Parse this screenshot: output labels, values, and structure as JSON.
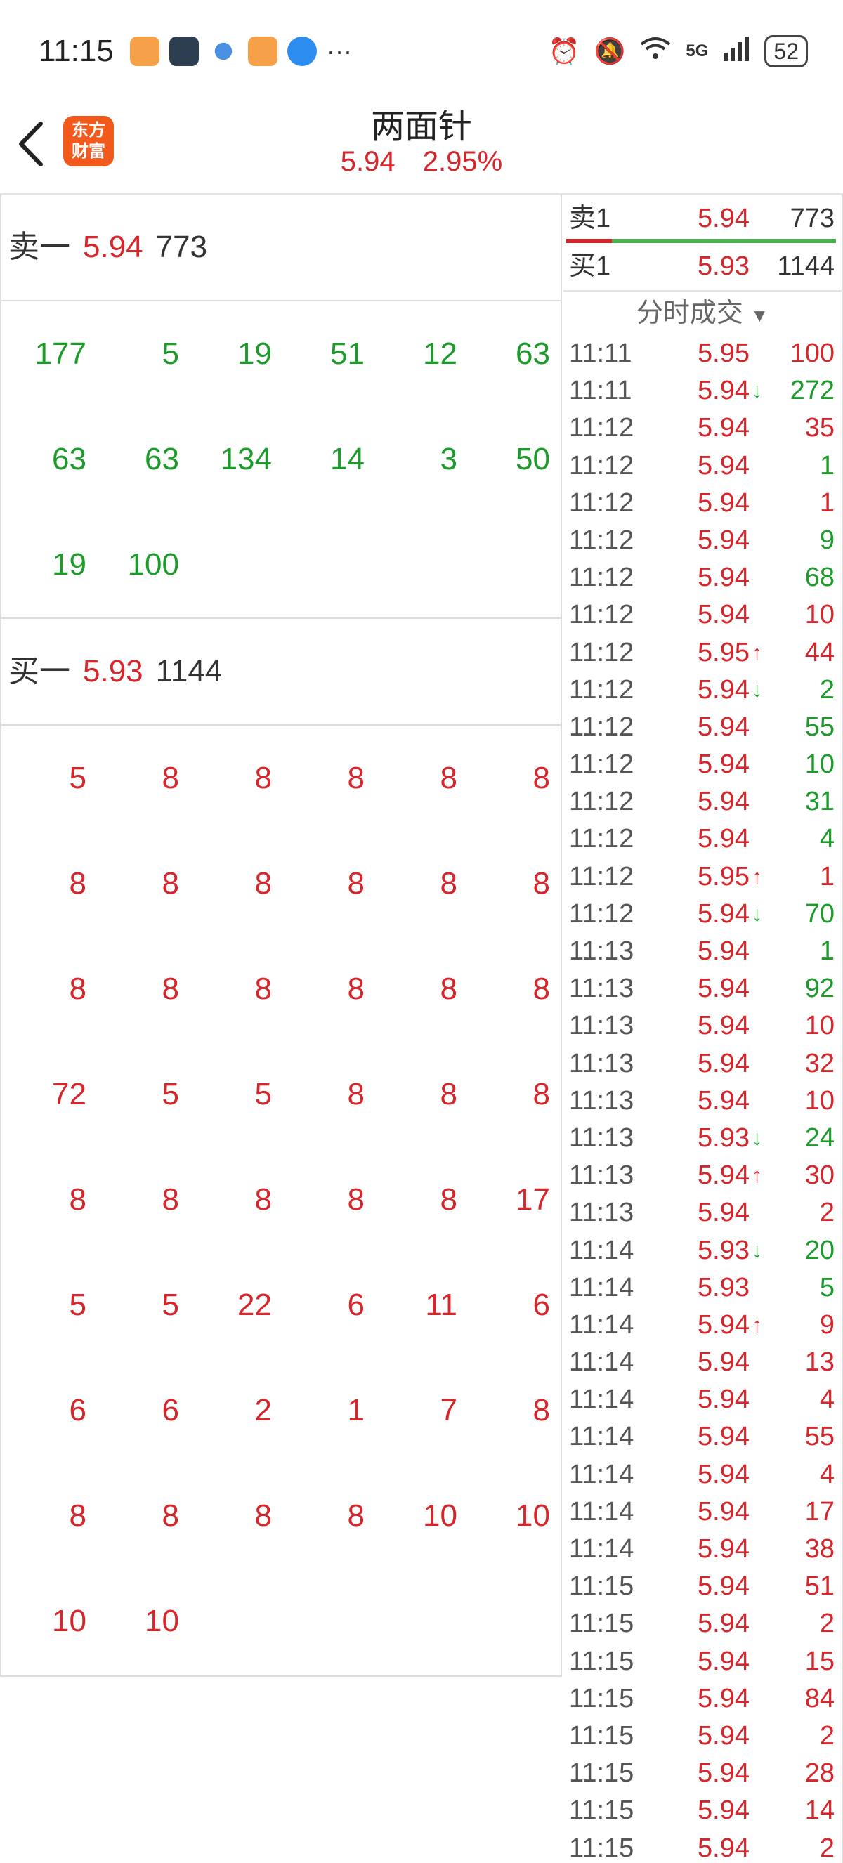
{
  "status_bar": {
    "time": "11:15",
    "battery": "52",
    "network": "5G",
    "more": "···",
    "icons_left": [
      "app-orange-heart-icon",
      "app-bot-icon",
      "app-planet-icon",
      "app-orange-heart-icon",
      "app-cloud-icon"
    ],
    "icons_right": [
      "alarm-icon",
      "mute-icon",
      "wifi-icon",
      "signal-icon",
      "battery-icon"
    ]
  },
  "header": {
    "logo_line1": "东方",
    "logo_line2": "财富",
    "title": "两面针",
    "price": "5.94",
    "change_pct": "2.95%",
    "logo_color": "#f25a1d"
  },
  "sell_one": {
    "label": "卖一",
    "price": "5.94",
    "qty": "773"
  },
  "sell_queue": [
    [
      "177",
      "5",
      "19",
      "51",
      "12",
      "63"
    ],
    [
      "63",
      "63",
      "134",
      "14",
      "3",
      "50"
    ],
    [
      "19",
      "100"
    ]
  ],
  "buy_one": {
    "label": "买一",
    "price": "5.93",
    "qty": "1144"
  },
  "buy_queue": [
    [
      "5",
      "8",
      "8",
      "8",
      "8",
      "8"
    ],
    [
      "8",
      "8",
      "8",
      "8",
      "8",
      "8"
    ],
    [
      "8",
      "8",
      "8",
      "8",
      "8",
      "8"
    ],
    [
      "72",
      "5",
      "5",
      "8",
      "8",
      "8"
    ],
    [
      "8",
      "8",
      "8",
      "8",
      "8",
      "17"
    ],
    [
      "5",
      "5",
      "22",
      "6",
      "11",
      "6"
    ],
    [
      "6",
      "6",
      "2",
      "1",
      "7",
      "8"
    ],
    [
      "8",
      "8",
      "8",
      "8",
      "10",
      "10"
    ],
    [
      "10",
      "10"
    ]
  ],
  "order_book": {
    "sell1": {
      "label": "卖1",
      "price": "5.94",
      "qty": "773"
    },
    "buy1": {
      "label": "买1",
      "price": "5.93",
      "qty": "1144"
    },
    "sell_ratio": 0.17
  },
  "trades_header": "分时成交",
  "trades": [
    {
      "time": "11:11",
      "price": "5.95",
      "arrow": "",
      "vol": "100",
      "dir": "buy"
    },
    {
      "time": "11:11",
      "price": "5.94",
      "arrow": "down",
      "vol": "272",
      "dir": "sell"
    },
    {
      "time": "11:12",
      "price": "5.94",
      "arrow": "",
      "vol": "35",
      "dir": "buy"
    },
    {
      "time": "11:12",
      "price": "5.94",
      "arrow": "",
      "vol": "1",
      "dir": "sell"
    },
    {
      "time": "11:12",
      "price": "5.94",
      "arrow": "",
      "vol": "1",
      "dir": "buy"
    },
    {
      "time": "11:12",
      "price": "5.94",
      "arrow": "",
      "vol": "9",
      "dir": "sell"
    },
    {
      "time": "11:12",
      "price": "5.94",
      "arrow": "",
      "vol": "68",
      "dir": "sell"
    },
    {
      "time": "11:12",
      "price": "5.94",
      "arrow": "",
      "vol": "10",
      "dir": "buy"
    },
    {
      "time": "11:12",
      "price": "5.95",
      "arrow": "up",
      "vol": "44",
      "dir": "buy"
    },
    {
      "time": "11:12",
      "price": "5.94",
      "arrow": "down",
      "vol": "2",
      "dir": "sell"
    },
    {
      "time": "11:12",
      "price": "5.94",
      "arrow": "",
      "vol": "55",
      "dir": "sell"
    },
    {
      "time": "11:12",
      "price": "5.94",
      "arrow": "",
      "vol": "10",
      "dir": "sell"
    },
    {
      "time": "11:12",
      "price": "5.94",
      "arrow": "",
      "vol": "31",
      "dir": "sell"
    },
    {
      "time": "11:12",
      "price": "5.94",
      "arrow": "",
      "vol": "4",
      "dir": "sell"
    },
    {
      "time": "11:12",
      "price": "5.95",
      "arrow": "up",
      "vol": "1",
      "dir": "buy"
    },
    {
      "time": "11:12",
      "price": "5.94",
      "arrow": "down",
      "vol": "70",
      "dir": "sell"
    },
    {
      "time": "11:13",
      "price": "5.94",
      "arrow": "",
      "vol": "1",
      "dir": "sell"
    },
    {
      "time": "11:13",
      "price": "5.94",
      "arrow": "",
      "vol": "92",
      "dir": "sell"
    },
    {
      "time": "11:13",
      "price": "5.94",
      "arrow": "",
      "vol": "10",
      "dir": "buy"
    },
    {
      "time": "11:13",
      "price": "5.94",
      "arrow": "",
      "vol": "32",
      "dir": "buy"
    },
    {
      "time": "11:13",
      "price": "5.94",
      "arrow": "",
      "vol": "10",
      "dir": "buy"
    },
    {
      "time": "11:13",
      "price": "5.93",
      "arrow": "down",
      "vol": "24",
      "dir": "sell"
    },
    {
      "time": "11:13",
      "price": "5.94",
      "arrow": "up",
      "vol": "30",
      "dir": "buy"
    },
    {
      "time": "11:13",
      "price": "5.94",
      "arrow": "",
      "vol": "2",
      "dir": "buy"
    },
    {
      "time": "11:14",
      "price": "5.93",
      "arrow": "down",
      "vol": "20",
      "dir": "sell"
    },
    {
      "time": "11:14",
      "price": "5.93",
      "arrow": "",
      "vol": "5",
      "dir": "sell"
    },
    {
      "time": "11:14",
      "price": "5.94",
      "arrow": "up",
      "vol": "9",
      "dir": "buy"
    },
    {
      "time": "11:14",
      "price": "5.94",
      "arrow": "",
      "vol": "13",
      "dir": "buy"
    },
    {
      "time": "11:14",
      "price": "5.94",
      "arrow": "",
      "vol": "4",
      "dir": "buy"
    },
    {
      "time": "11:14",
      "price": "5.94",
      "arrow": "",
      "vol": "55",
      "dir": "buy"
    },
    {
      "time": "11:14",
      "price": "5.94",
      "arrow": "",
      "vol": "4",
      "dir": "buy"
    },
    {
      "time": "11:14",
      "price": "5.94",
      "arrow": "",
      "vol": "17",
      "dir": "buy"
    },
    {
      "time": "11:14",
      "price": "5.94",
      "arrow": "",
      "vol": "38",
      "dir": "buy"
    },
    {
      "time": "11:15",
      "price": "5.94",
      "arrow": "",
      "vol": "51",
      "dir": "buy"
    },
    {
      "time": "11:15",
      "price": "5.94",
      "arrow": "",
      "vol": "2",
      "dir": "buy"
    },
    {
      "time": "11:15",
      "price": "5.94",
      "arrow": "",
      "vol": "15",
      "dir": "buy"
    },
    {
      "time": "11:15",
      "price": "5.94",
      "arrow": "",
      "vol": "84",
      "dir": "buy"
    },
    {
      "time": "11:15",
      "price": "5.94",
      "arrow": "",
      "vol": "2",
      "dir": "buy"
    },
    {
      "time": "11:15",
      "price": "5.94",
      "arrow": "",
      "vol": "28",
      "dir": "buy"
    },
    {
      "time": "11:15",
      "price": "5.94",
      "arrow": "",
      "vol": "14",
      "dir": "buy"
    },
    {
      "time": "11:15",
      "price": "5.94",
      "arrow": "",
      "vol": "2",
      "dir": "buy"
    }
  ],
  "colors": {
    "up": "#d7262b",
    "down": "#1c9a2a"
  }
}
